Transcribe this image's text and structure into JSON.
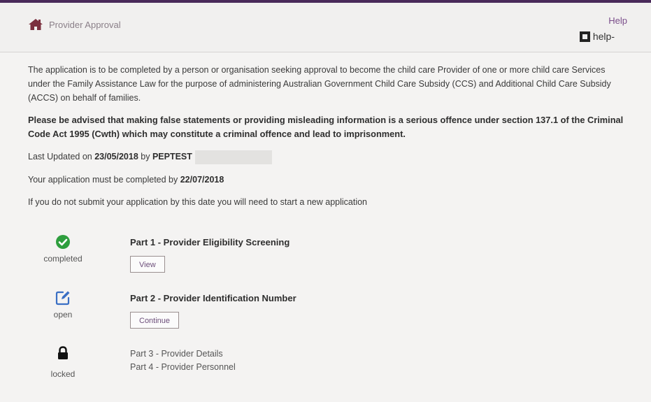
{
  "header": {
    "title": "Provider Approval",
    "help_link": "Help",
    "help_badge": "help-"
  },
  "intro": {
    "paragraph": "The application is to be completed by a person or organisation seeking approval to become the child care Provider of one or more child care Services under the Family Assistance Law for the purpose of administering Australian Government Child Care Subsidy (CCS) and Additional Child Care Subsidy (ACCS) on behalf of families.",
    "warning": "Please be advised that making false statements or providing misleading information is a serious offence under section 137.1 of the Criminal Code Act 1995 (Cwth) which may constitute a criminal offence and lead to imprisonment.",
    "last_updated_prefix": "Last Updated on ",
    "last_updated_date": "23/05/2018",
    "last_updated_by": " by ",
    "last_updated_user": "PEPTEST",
    "deadline_prefix": "Your application must be completed by ",
    "deadline_date": "22/07/2018",
    "notice": "If you do not submit your application by this date you will need to start a new application"
  },
  "steps": [
    {
      "status": "completed",
      "icon": "check-circle-icon",
      "title": "Part 1 - Provider Eligibility Screening",
      "button": "View"
    },
    {
      "status": "open",
      "icon": "edit-icon",
      "title": "Part 2 - Provider Identification Number",
      "button": "Continue"
    },
    {
      "status": "locked",
      "icon": "lock-icon",
      "items": [
        "Part 3 - Provider Details",
        "Part 4 - Provider Personnel"
      ]
    }
  ],
  "colors": {
    "accent": "#7a4d8a",
    "complete": "#2e9e3e",
    "edit": "#3a6fc4",
    "topbar": "#4a2a5a"
  }
}
